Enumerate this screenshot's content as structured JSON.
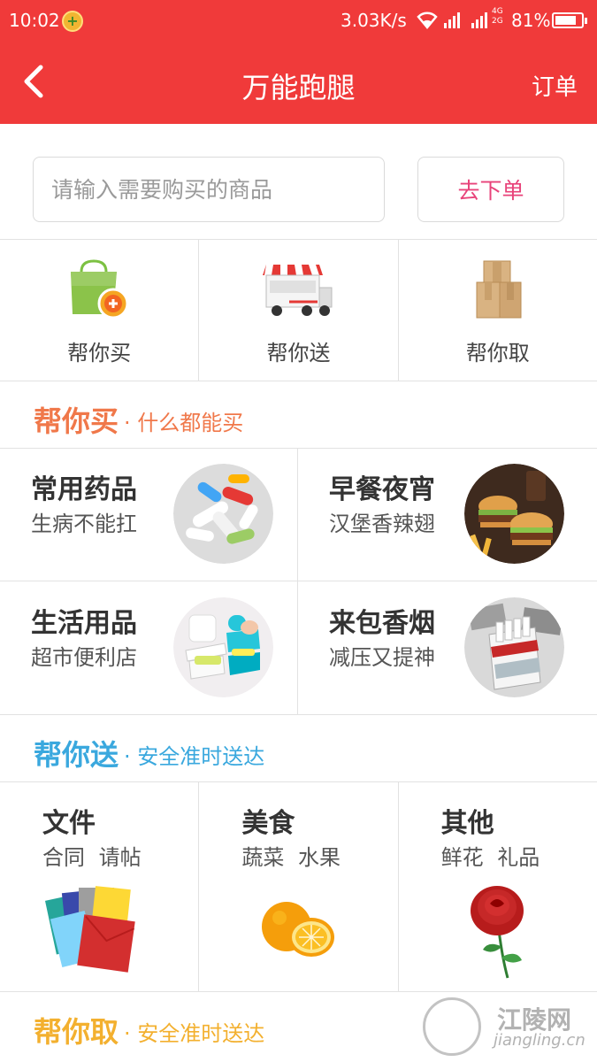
{
  "status_bar": {
    "time": "10:02",
    "network_speed": "3.03K/s",
    "network_type": "4G 2G",
    "battery_percent": "81%",
    "battery_level": 0.81
  },
  "header": {
    "title": "万能跑腿",
    "orders_label": "订单",
    "back_icon": "chevron-left-icon"
  },
  "search": {
    "placeholder": "请输入需要购买的商品",
    "button_label": "去下单"
  },
  "services": [
    {
      "label": "帮你买",
      "icon": "shopping-bag-icon"
    },
    {
      "label": "帮你送",
      "icon": "delivery-truck-icon"
    },
    {
      "label": "帮你取",
      "icon": "package-boxes-icon"
    }
  ],
  "sections": {
    "buy": {
      "title": "帮你买",
      "subtitle": "· 什么都能买",
      "color": "#f0784a"
    },
    "send": {
      "title": "帮你送",
      "subtitle": "· 安全准时送达",
      "color": "#3aa8de"
    },
    "fetch": {
      "title": "帮你取",
      "subtitle": "· 安全准时送达",
      "color": "#f3b02f"
    }
  },
  "buy_items": [
    {
      "title": "常用药品",
      "subtitle": "生病不能扛",
      "image": "pills-image"
    },
    {
      "title": "早餐夜宵",
      "subtitle": "汉堡香辣翅",
      "image": "burgers-image"
    },
    {
      "title": "生活用品",
      "subtitle": "超市便利店",
      "image": "soap-dish-image"
    },
    {
      "title": "来包香烟",
      "subtitle": "减压又提神",
      "image": "cigarettes-image"
    }
  ],
  "send_items": [
    {
      "title": "文件",
      "subtitle": "合同 请帖",
      "image": "envelopes-image"
    },
    {
      "title": "美食",
      "subtitle": "蔬菜 水果",
      "image": "oranges-image"
    },
    {
      "title": "其他",
      "subtitle": "鲜花 礼品",
      "image": "rose-image"
    }
  ],
  "watermark": {
    "name": "江陵网",
    "url": "jiangling.cn"
  },
  "colors": {
    "primary": "#f03a3a",
    "order_button_text": "#e8437a"
  }
}
